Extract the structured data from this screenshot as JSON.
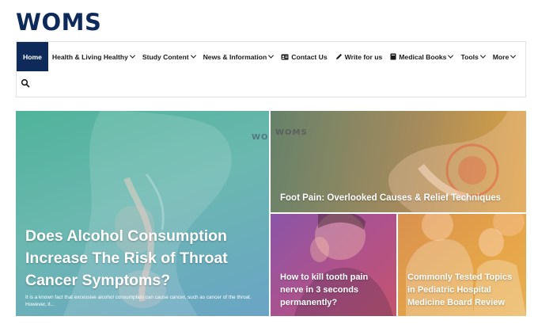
{
  "site": {
    "logo": "WOMS"
  },
  "nav": {
    "items": [
      {
        "label": "Home",
        "active": true
      },
      {
        "label": "Health & Living Healthy",
        "dropdown": true
      },
      {
        "label": "Study Content",
        "dropdown": true
      },
      {
        "label": "News & Information",
        "dropdown": true
      },
      {
        "label": "Contact Us",
        "icon": "contact-card-icon"
      },
      {
        "label": "Write for us",
        "icon": "pen-icon"
      },
      {
        "label": "Medical Books",
        "icon": "book-icon",
        "dropdown": true
      },
      {
        "label": "Tools",
        "dropdown": true
      },
      {
        "label": "More",
        "dropdown": true
      }
    ],
    "search_icon": "search-icon",
    "active_color": "#0e2a5a"
  },
  "posts": {
    "featured": {
      "title": "Does Alcohol Consumption Increase The Risk of Throat Cancer Symptoms?",
      "excerpt": "It is a known fact that excessive alcohol consumption can cause cancer, such as cancer of the throat. However, it...",
      "watermark": "WOMS"
    },
    "top_right": {
      "title": "Foot Pain: Overlooked Causes & Relief Techniques",
      "watermark": "WOMS"
    },
    "bottom_mid": {
      "title": "How to kill tooth pain nerve in 3 seconds permanently?"
    },
    "bottom_right": {
      "title": "Commonly Tested Topics in Pediatric Hospital Medicine Board Review"
    }
  }
}
